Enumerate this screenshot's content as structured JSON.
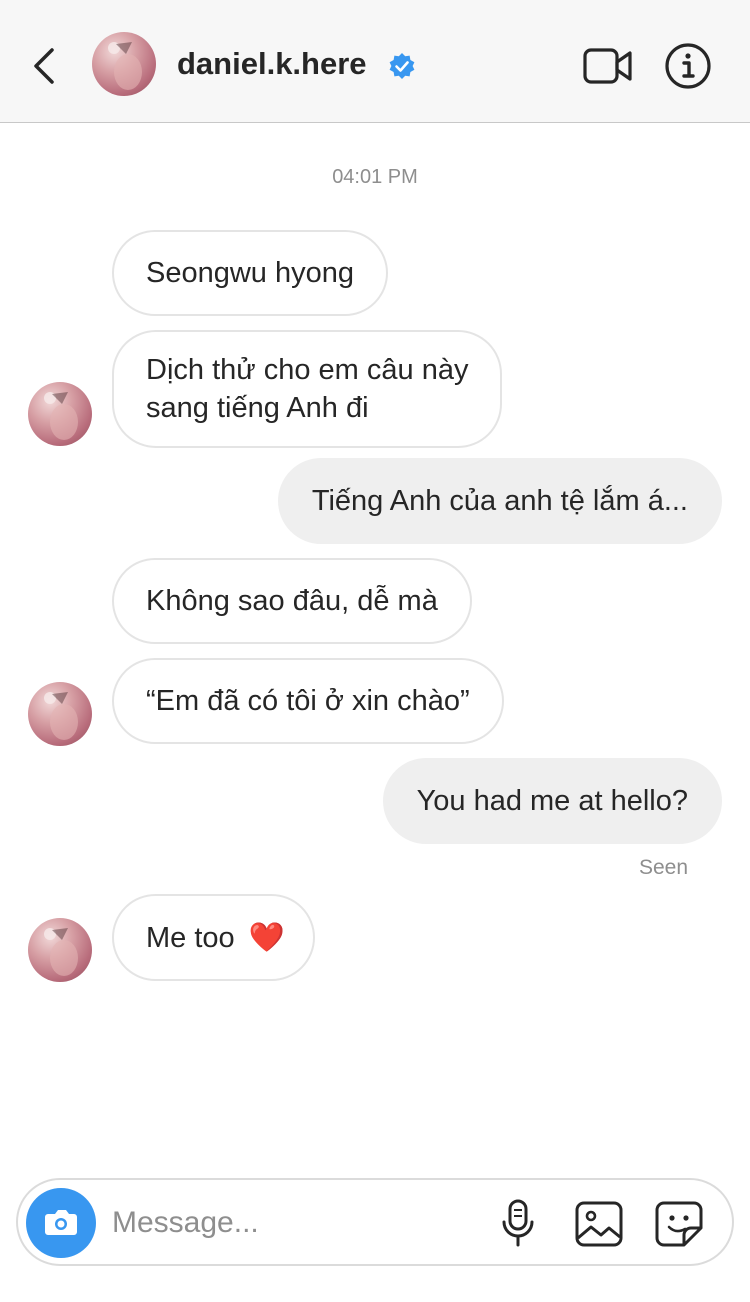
{
  "header": {
    "username": "daniel.k.here",
    "verified": true
  },
  "thread": {
    "timestamp": "04:01 PM",
    "messages": [
      {
        "from": "them",
        "text": "Seongwu hyong"
      },
      {
        "from": "them",
        "text_lines": [
          "Dịch thử cho em câu này",
          "sang tiếng Anh đi"
        ]
      },
      {
        "from": "me",
        "text": "Tiếng Anh của anh tệ lắm á..."
      },
      {
        "from": "them",
        "text": "Không sao đâu, dễ mà"
      },
      {
        "from": "them",
        "text": "“Em đã có tôi ở xin chào”"
      },
      {
        "from": "me",
        "text": "You had me at hello?"
      },
      {
        "from": "them",
        "text": "Me too",
        "emoji": "❤️"
      }
    ],
    "seen_label": "Seen"
  },
  "composer": {
    "placeholder": "Message..."
  },
  "icons": {
    "back": "chevron-left-icon",
    "video": "video-camera-icon",
    "info": "info-icon",
    "camera": "camera-icon",
    "mic": "microphone-icon",
    "gallery": "image-icon",
    "sticker": "sticker-icon"
  },
  "colors": {
    "accent": "#3897f0",
    "verified_badge": "#3897f0",
    "bubble_out": "#efefef",
    "heart": "#e0262b"
  }
}
